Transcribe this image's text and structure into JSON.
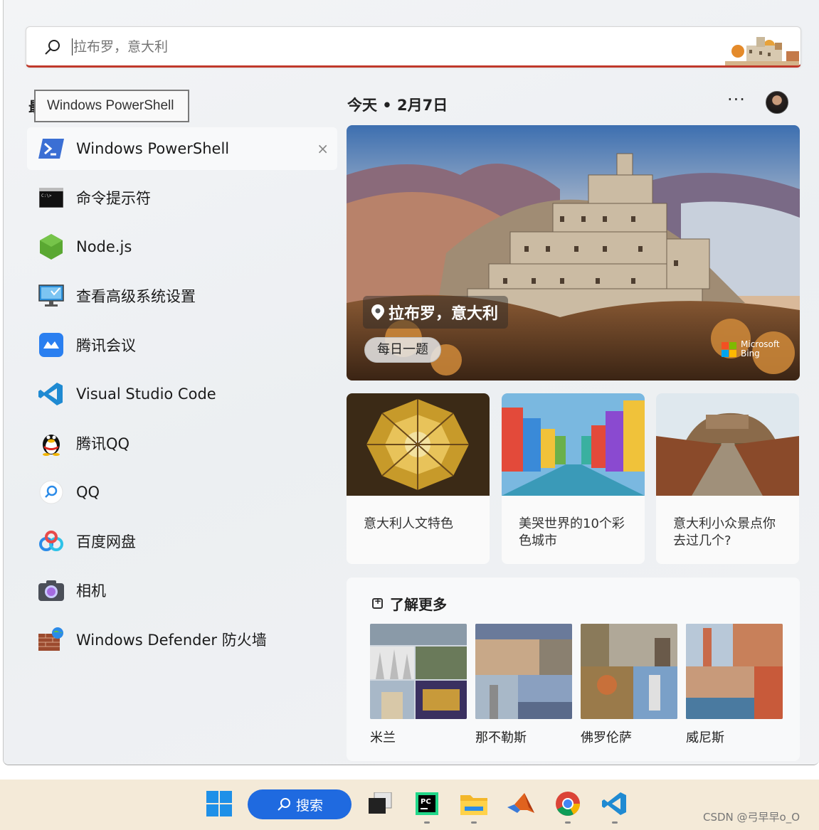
{
  "search": {
    "placeholder": "拉布罗，意大利"
  },
  "left": {
    "header_char": "最",
    "tooltip": "Windows PowerShell",
    "apps": [
      {
        "label": "Windows PowerShell",
        "icon": "powershell-icon"
      },
      {
        "label": "命令提示符",
        "icon": "cmd-icon"
      },
      {
        "label": "Node.js",
        "icon": "nodejs-icon"
      },
      {
        "label": "查看高级系统设置",
        "icon": "system-settings-icon"
      },
      {
        "label": "腾讯会议",
        "icon": "tencent-meeting-icon"
      },
      {
        "label": "Visual Studio Code",
        "icon": "vscode-icon"
      },
      {
        "label": "腾讯QQ",
        "icon": "qq-penguin-icon"
      },
      {
        "label": "QQ",
        "icon": "qq-search-icon"
      },
      {
        "label": "百度网盘",
        "icon": "baidu-netdisk-icon"
      },
      {
        "label": "相机",
        "icon": "camera-icon"
      },
      {
        "label": "Windows Defender 防火墙",
        "icon": "firewall-icon"
      }
    ]
  },
  "right": {
    "date_heading": "今天 • 2月7日",
    "more_label": "···",
    "hero": {
      "location": "拉布罗，意大利",
      "quiz": "每日一题",
      "brand_line1": "Microsoft",
      "brand_line2": "Bing"
    },
    "cards": [
      {
        "caption": "意大利人文特色"
      },
      {
        "caption": "美哭世界的10个彩色城市"
      },
      {
        "caption": "意大利小众景点你去过几个?"
      }
    ],
    "learn_more": {
      "title": "了解更多",
      "cities": [
        {
          "name": "米兰"
        },
        {
          "name": "那不勒斯"
        },
        {
          "name": "佛罗伦萨"
        },
        {
          "name": "威尼斯"
        }
      ]
    }
  },
  "taskbar": {
    "search_label": "搜索",
    "items": [
      "start-icon",
      "task-view-icon",
      "pycharm-icon",
      "file-explorer-icon",
      "matlab-icon",
      "chrome-icon",
      "vscode-icon"
    ]
  },
  "watermark": "CSDN @弓早早o_O",
  "colors": {
    "accent": "#1f6ae0",
    "search_underline": "#c0392b",
    "taskbar_bg": "#f4ead8"
  }
}
